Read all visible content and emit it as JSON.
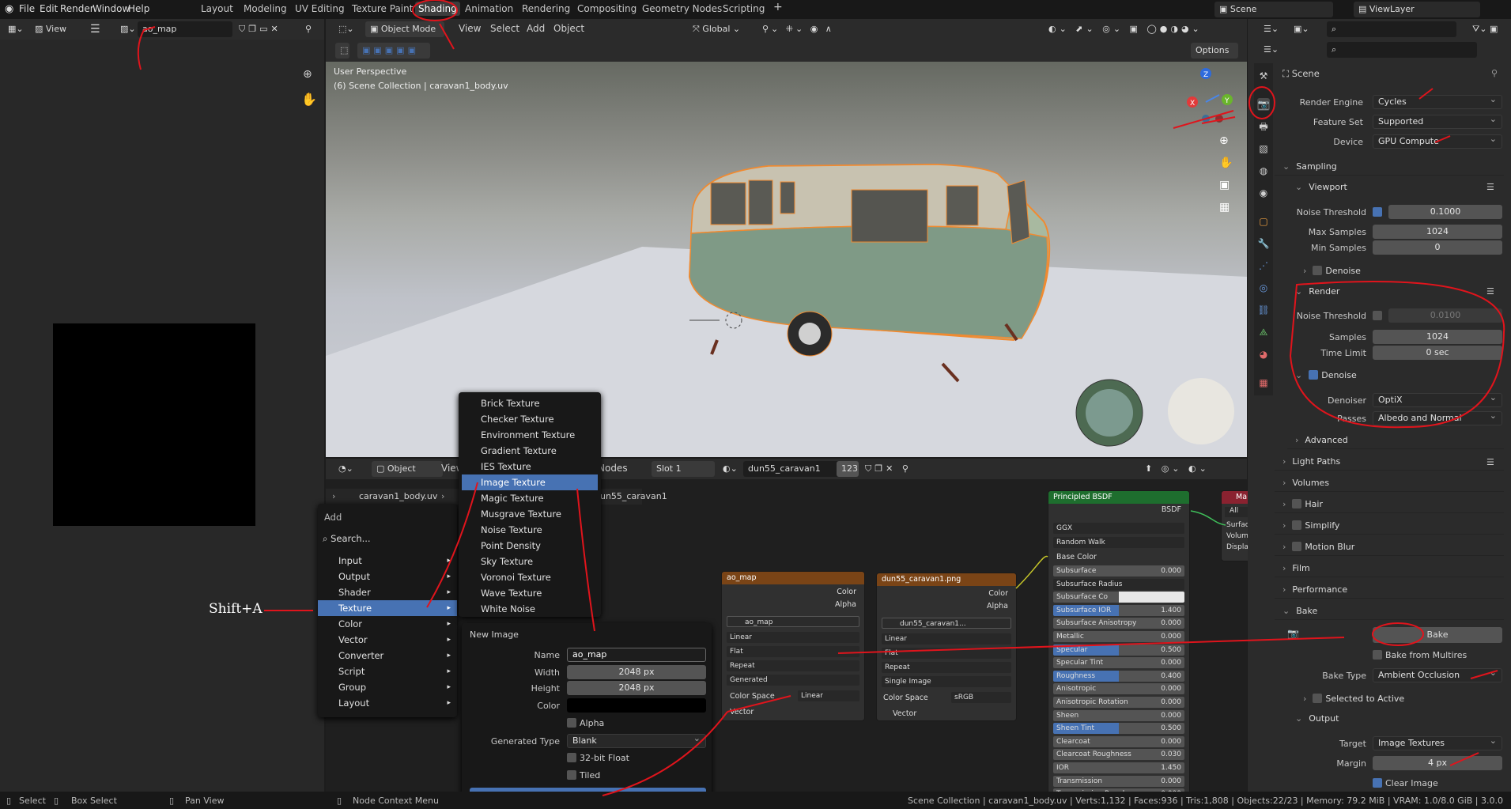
{
  "app": {
    "menus": [
      "File",
      "Edit",
      "Render",
      "Window",
      "Help"
    ],
    "workspaces": [
      "Layout",
      "Modeling",
      "UV Editing",
      "Texture Paint",
      "Shading",
      "Animation",
      "Rendering",
      "Compositing",
      "Geometry Nodes",
      "Scripting"
    ],
    "active_workspace": "Shading",
    "scene": "Scene",
    "view_layer": "ViewLayer"
  },
  "image_editor": {
    "view_label": "View",
    "image_name": "ao_map"
  },
  "viewport": {
    "mode": "Object Mode",
    "menus": [
      "View",
      "Select",
      "Add",
      "Object"
    ],
    "transform": "Global",
    "options": "Options",
    "overlay_title": "User Perspective",
    "overlay_sub": "(6) Scene Collection | caravan1_body.uv"
  },
  "node_editor": {
    "mode": "Object",
    "view": "View",
    "nodes_tab": "Nodes",
    "slot": "Slot 1",
    "material": "dun55_caravan1",
    "users": "123",
    "breadcrumb_obj": "caravan1_body.uv",
    "breadcrumb_mat": "dun55_caravan1"
  },
  "add_menu": {
    "title": "Add",
    "search": "Search...",
    "items": [
      "Input",
      "Output",
      "Shader",
      "Texture",
      "Color",
      "Vector",
      "Converter",
      "Script",
      "Group",
      "Layout"
    ],
    "selected": "Texture"
  },
  "texture_menu": {
    "items": [
      "Brick Texture",
      "Checker Texture",
      "Environment Texture",
      "Gradient Texture",
      "IES Texture",
      "Image Texture",
      "Magic Texture",
      "Musgrave Texture",
      "Noise Texture",
      "Point Density",
      "Sky Texture",
      "Voronoi Texture",
      "Wave Texture",
      "White Noise"
    ],
    "selected": "Image Texture"
  },
  "annotation": {
    "shortcut": "Shift+A"
  },
  "new_image": {
    "title": "New Image",
    "name_label": "Name",
    "name": "ao_map",
    "width_label": "Width",
    "width": "2048 px",
    "height_label": "Height",
    "height": "2048 px",
    "color_label": "Color",
    "alpha": "Alpha",
    "gen_type_label": "Generated Type",
    "gen_type": "Blank",
    "float": "32-bit Float",
    "tiled": "Tiled",
    "ok": "OK"
  },
  "node_ao": {
    "title": "ao_map",
    "out_color": "Color",
    "out_alpha": "Alpha",
    "image": "ao_map",
    "interp": "Linear",
    "proj": "Flat",
    "ext": "Repeat",
    "source": "Generated",
    "cs_label": "Color Space",
    "cs": "Linear",
    "in_vector": "Vector"
  },
  "node_dun": {
    "title": "dun55_caravan1.png",
    "out_color": "Color",
    "out_alpha": "Alpha",
    "image": "dun55_caravan1...",
    "interp": "Linear",
    "proj": "Flat",
    "ext": "Repeat",
    "source": "Single Image",
    "cs_label": "Color Space",
    "cs": "sRGB",
    "in_vector": "Vector"
  },
  "bsdf": {
    "title": "Principled BSDF",
    "out": "BSDF",
    "distribution": "GGX",
    "sss_method": "Random Walk",
    "base_color": "Base Color",
    "rows": [
      [
        "Subsurface",
        "0.000"
      ],
      [
        "Subsurface Radius",
        ""
      ],
      [
        "Subsurface Co",
        ""
      ],
      [
        "Subsurface IOR",
        "1.400"
      ],
      [
        "Subsurface Anisotropy",
        "0.000"
      ],
      [
        "Metallic",
        "0.000"
      ],
      [
        "Specular",
        "0.500"
      ],
      [
        "Specular Tint",
        "0.000"
      ],
      [
        "Roughness",
        "0.400"
      ],
      [
        "Anisotropic",
        "0.000"
      ],
      [
        "Anisotropic Rotation",
        "0.000"
      ],
      [
        "Sheen",
        "0.000"
      ],
      [
        "Sheen Tint",
        "0.500"
      ],
      [
        "Clearcoat",
        "0.000"
      ],
      [
        "Clearcoat Roughness",
        "0.030"
      ],
      [
        "IOR",
        "1.450"
      ],
      [
        "Transmission",
        "0.000"
      ],
      [
        "Transmission Roughness",
        "0.000"
      ]
    ]
  },
  "mat_out": {
    "title": "Ma",
    "target": "All",
    "inputs": [
      "Surface",
      "Volume",
      "Displace"
    ]
  },
  "properties": {
    "scene": "Scene",
    "render_engine_label": "Render Engine",
    "render_engine": "Cycles",
    "feature_set_label": "Feature Set",
    "feature_set": "Supported",
    "device_label": "Device",
    "device": "GPU Compute",
    "sampling": "Sampling",
    "viewport": "Viewport",
    "vp_noise_label": "Noise Threshold",
    "vp_noise": "0.1000",
    "vp_max_label": "Max Samples",
    "vp_max": "1024",
    "vp_min_label": "Min Samples",
    "vp_min": "0",
    "denoise": "Denoise",
    "render": "Render",
    "r_noise_label": "Noise Threshold",
    "r_noise": "0.0100",
    "r_samples_label": "Samples",
    "r_samples": "1024",
    "r_time_label": "Time Limit",
    "r_time": "0 sec",
    "r_denoise": "Denoise",
    "denoiser_label": "Denoiser",
    "denoiser": "OptiX",
    "passes_label": "Passes",
    "passes": "Albedo and Normal",
    "advanced": "Advanced",
    "light_paths": "Light Paths",
    "volumes": "Volumes",
    "hair": "Hair",
    "simplify": "Simplify",
    "motion_blur": "Motion Blur",
    "film": "Film",
    "performance": "Performance",
    "bake": "Bake",
    "bake_button": "Bake",
    "bake_multires": "Bake from Multires",
    "bake_type_label": "Bake Type",
    "bake_type": "Ambient Occlusion",
    "selected_to_active": "Selected to Active",
    "output": "Output",
    "target_label": "Target",
    "target": "Image Textures",
    "margin_label": "Margin",
    "margin": "4 px",
    "clear_image": "Clear Image"
  },
  "statusbar": {
    "select": "Select",
    "box_select": "Box Select",
    "pan_view": "Pan View",
    "context": "Node Context Menu",
    "stats": "Scene Collection | caravan1_body.uv | Verts:1,132 | Faces:936 | Tris:1,808 | Objects:22/23 | Memory: 79.2 MiB | VRAM: 1.0/8.0 GiB | 3.0.0"
  },
  "colors": {
    "accent": "#4772b3",
    "annotation": "#e0141c",
    "image_node_header": "#7a4416",
    "bsdf_header": "#1e6e2e"
  }
}
